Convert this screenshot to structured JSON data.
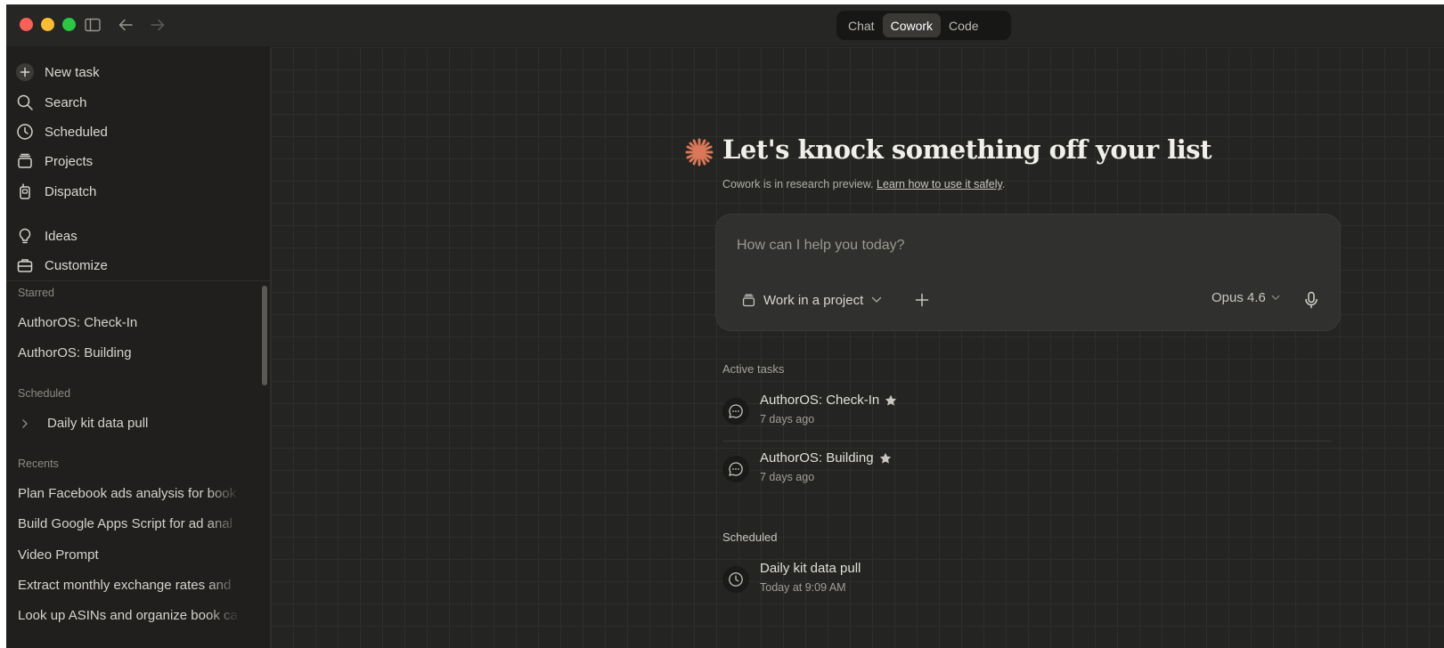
{
  "window": {
    "mode_tabs": [
      "Chat",
      "Cowork",
      "Code"
    ],
    "active_mode": "Cowork"
  },
  "sidebar": {
    "nav": {
      "new_task": "New task",
      "search": "Search",
      "scheduled": "Scheduled",
      "projects": "Projects",
      "dispatch": "Dispatch",
      "ideas": "Ideas",
      "customize": "Customize"
    },
    "starred_label": "Starred",
    "starred": [
      "AuthorOS: Check-In",
      "AuthorOS: Building"
    ],
    "scheduled_label": "Scheduled",
    "scheduled": [
      "Daily kit data pull"
    ],
    "recents_label": "Recents",
    "recents": [
      "Plan Facebook ads analysis for book",
      "Build Google Apps Script for ad anal",
      "Video Prompt",
      "Extract monthly exchange rates and",
      "Look up ASINs and organize book ca"
    ]
  },
  "main": {
    "title": "Let's knock something off your list",
    "subtitle": "Cowork is in research preview.",
    "subtitle_link": "Learn how to use it safely",
    "subtitle_end": ".",
    "composer": {
      "placeholder": "How can I help you today?",
      "project_label": "Work in a project",
      "model": "Opus 4.6"
    },
    "active_tasks_label": "Active tasks",
    "active_tasks": [
      {
        "title": "AuthorOS: Check-In",
        "time": "7 days ago",
        "starred": true
      },
      {
        "title": "AuthorOS: Building",
        "time": "7 days ago",
        "starred": true
      }
    ],
    "scheduled_label": "Scheduled",
    "scheduled": [
      {
        "title": "Daily kit data pull",
        "time": "Today at 9:09 AM"
      }
    ]
  },
  "colors": {
    "accent": "#d97757",
    "background": "#262624",
    "sidebar": "#201f1d"
  },
  "icons": {
    "sidebar_toggle": "sidebar-toggle-icon",
    "back": "arrow-left-icon",
    "forward": "arrow-right-icon",
    "logo": "claude-starburst-icon"
  }
}
